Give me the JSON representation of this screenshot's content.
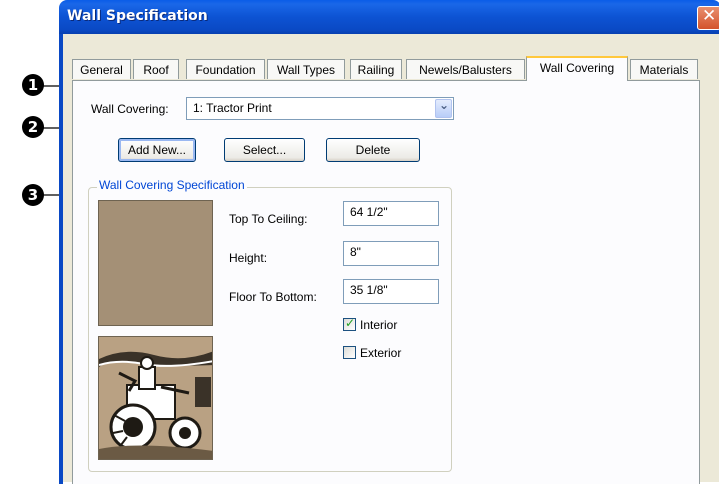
{
  "dialog": {
    "title": "Wall Specification"
  },
  "tabs": [
    {
      "label": "General"
    },
    {
      "label": "Roof"
    },
    {
      "label": "Foundation"
    },
    {
      "label": "Wall Types"
    },
    {
      "label": "Railing"
    },
    {
      "label": "Newels/Balusters"
    },
    {
      "label": "Wall Covering",
      "active": true
    },
    {
      "label": "Materials"
    }
  ],
  "wall_covering": {
    "label": "Wall Covering:",
    "selected": "1:  Tractor Print",
    "buttons": {
      "add_new": "Add New...",
      "select": "Select...",
      "delete": "Delete"
    }
  },
  "specification": {
    "group_title": "Wall Covering Specification",
    "top_to_ceiling_label": "Top To Ceiling:",
    "top_to_ceiling_value": "64 1/2\"",
    "height_label": "Height:",
    "height_value": "8\"",
    "floor_to_bottom_label": "Floor To Bottom:",
    "floor_to_bottom_value": "35 1/8\"",
    "interior_label": "Interior",
    "interior_checked": true,
    "exterior_label": "Exterior",
    "exterior_checked": false,
    "swatch_color": "#a49076"
  },
  "callouts": [
    "1",
    "2",
    "3"
  ],
  "icons": {
    "close": "close-icon",
    "dropdown": "chevron-down-icon",
    "check": "check-icon"
  }
}
